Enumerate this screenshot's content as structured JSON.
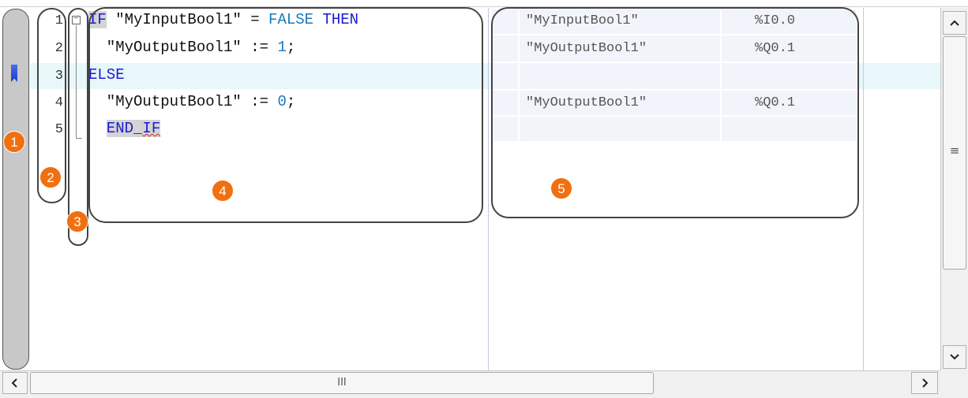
{
  "editor": {
    "lines": [
      {
        "number": "1",
        "t1": "IF",
        "t2": " \"MyInputBool1\" = ",
        "t3": "FALSE",
        "t4": " ",
        "t5": "THEN"
      },
      {
        "number": "2",
        "t1": "  \"MyOutputBool1\" := ",
        "t2": "1",
        "t3": ";"
      },
      {
        "number": "3",
        "t1": "ELSE"
      },
      {
        "number": "4",
        "t1": "  \"MyOutputBool1\" := ",
        "t2": "0",
        "t3": ";"
      },
      {
        "number": "5",
        "t1": "  ",
        "t2": "END_",
        "t3": "IF"
      }
    ],
    "fold_symbol": "−"
  },
  "tag_column": {
    "rows": [
      {
        "name": "\"MyInputBool1\"",
        "address": "%I0.0"
      },
      {
        "name": "\"MyOutputBool1\"",
        "address": "%Q0.1"
      },
      {
        "name": "",
        "address": ""
      },
      {
        "name": "\"MyOutputBool1\"",
        "address": "%Q0.1"
      },
      {
        "name": "",
        "address": ""
      }
    ]
  },
  "callouts": [
    "1",
    "2",
    "3",
    "4",
    "5"
  ],
  "scrollbar": {
    "up_icon": "chevron-up-icon",
    "down_icon": "chevron-down-icon",
    "left_icon": "chevron-left-icon",
    "right_icon": "chevron-right-icon",
    "grip_v": "≡",
    "grip_h": "III"
  },
  "colors": {
    "callout": "#f07010",
    "keyword": "#1a1ad6",
    "constant": "#1878b8",
    "highlight_row": "#e8f7fa"
  }
}
